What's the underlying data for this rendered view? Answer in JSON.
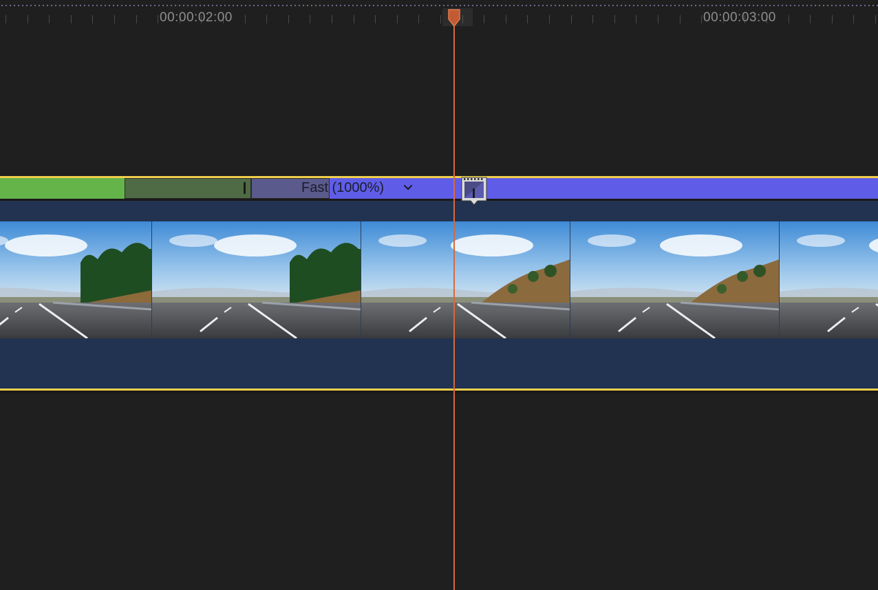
{
  "ruler": {
    "timecodes": [
      "00:00:02:00",
      "00:00:03:00"
    ]
  },
  "retime": {
    "label": "Fast (1000%)",
    "colors": {
      "normal": "#64b44a",
      "fast": "#5f5de8"
    }
  },
  "clip": {
    "border_color": "#f1d04b",
    "frame_count": 5
  },
  "playhead": {
    "color": "#d9683c"
  },
  "icons": {
    "playhead": "playhead-marker-icon",
    "retime_menu": "chevron-down-icon",
    "video_marker": "film-frame-icon"
  }
}
